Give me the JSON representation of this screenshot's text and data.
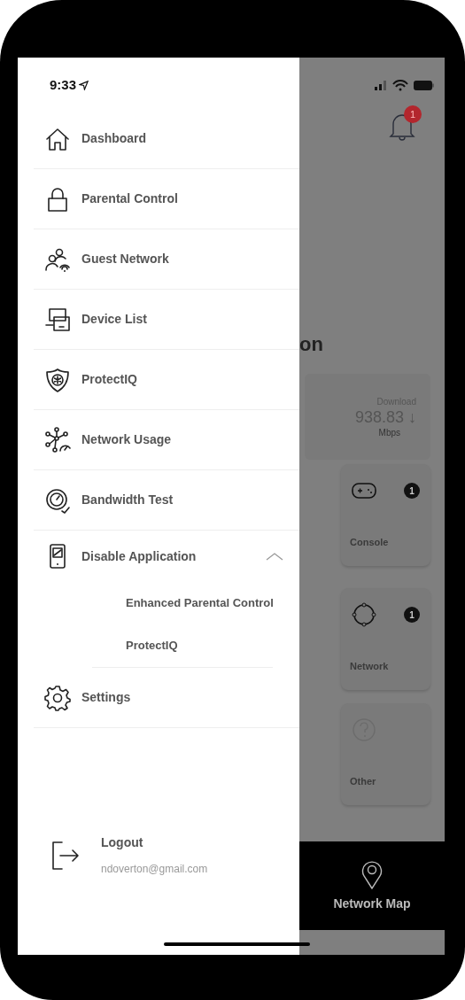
{
  "status_bar": {
    "time": "9:33"
  },
  "menu": {
    "items": [
      {
        "label": "Dashboard"
      },
      {
        "label": "Parental Control"
      },
      {
        "label": "Guest Network"
      },
      {
        "label": "Device List"
      },
      {
        "label": "ProtectIQ"
      },
      {
        "label": "Network Usage"
      },
      {
        "label": "Bandwidth Test"
      },
      {
        "label": "Disable Application",
        "expanded": true,
        "children": [
          {
            "label": "Enhanced Parental Control"
          },
          {
            "label": "ProtectIQ"
          }
        ]
      },
      {
        "label": "Settings"
      }
    ]
  },
  "logout": {
    "label": "Logout",
    "email": "ndoverton@gmail.com"
  },
  "background": {
    "notification_count": "1",
    "heading": "on",
    "download": {
      "label": "Download",
      "value": "938.83",
      "arrow": "↓",
      "unit": "Mbps"
    },
    "cards": [
      {
        "label": "Console",
        "count": "1"
      },
      {
        "label": "Network",
        "count": "1"
      },
      {
        "label": "Other"
      }
    ],
    "nav": {
      "label": "Network Map"
    }
  }
}
